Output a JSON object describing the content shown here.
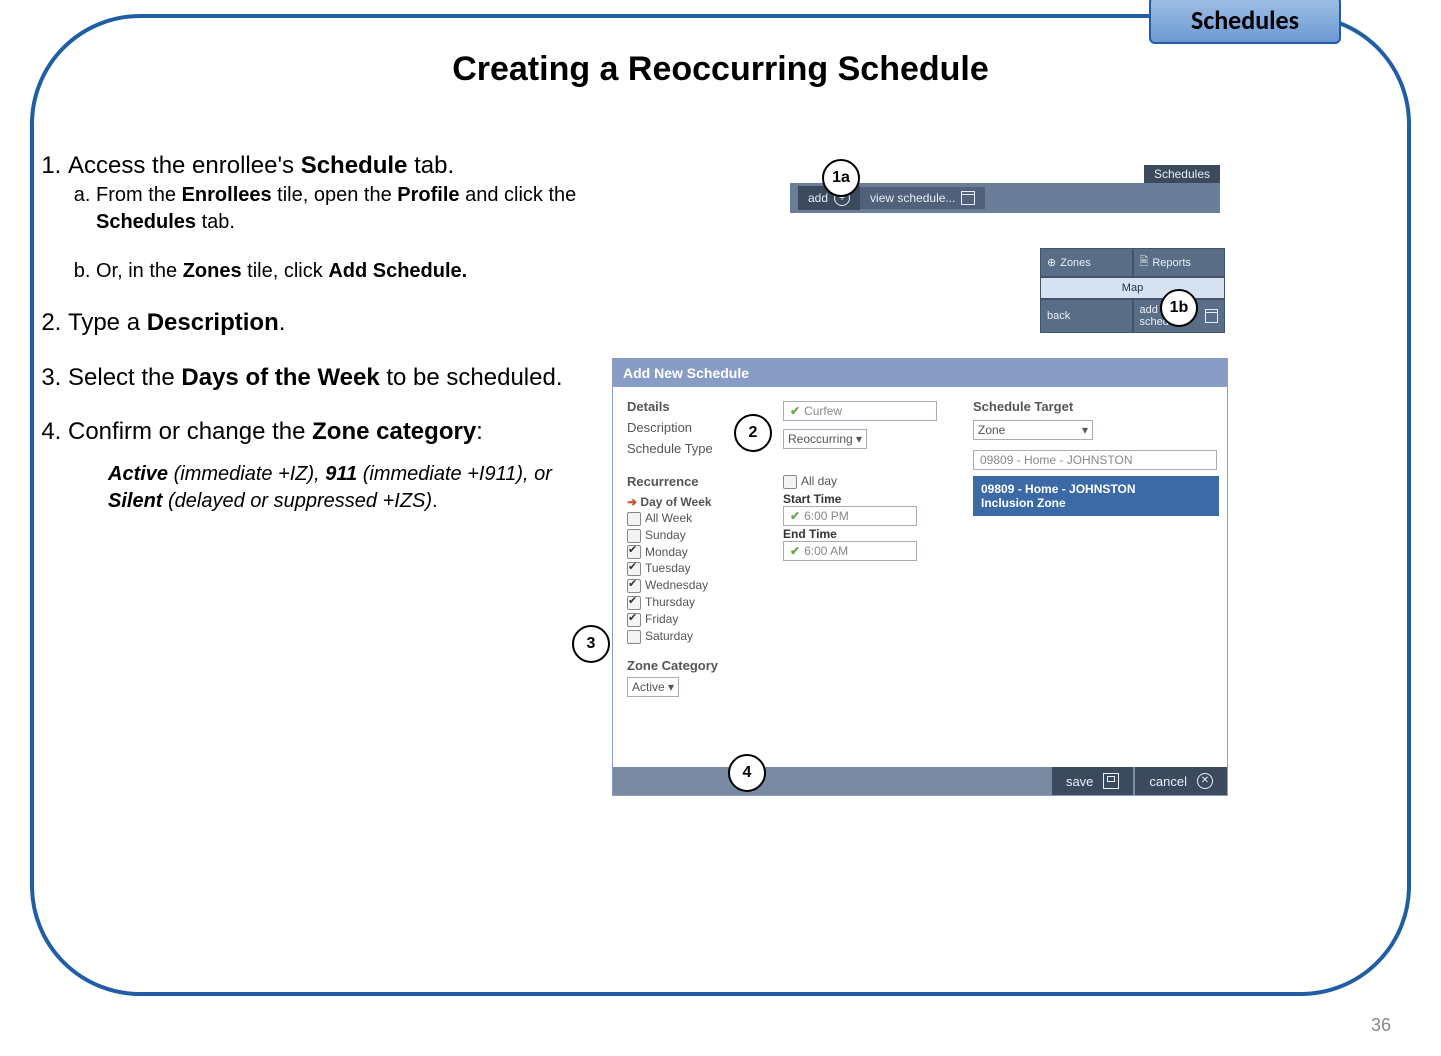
{
  "page": {
    "tab_label": "Schedules",
    "title": "Creating a Reoccurring Schedule",
    "page_number": "36"
  },
  "steps": {
    "s1": "Access the enrollee's ",
    "s1_bold": "Schedule",
    "s1_tail": " tab.",
    "s1a_pre": "From the ",
    "s1a_b1": "Enrollees",
    "s1a_mid": " tile, open the ",
    "s1a_b2": "Profile",
    "s1a_mid2": " and click the ",
    "s1a_b3": "Schedules",
    "s1a_tail": " tab.",
    "s1b_pre": "Or, in the ",
    "s1b_b1": "Zones",
    "s1b_mid": " tile, click ",
    "s1b_b2": "Add Schedule.",
    "s2_pre": "Type a ",
    "s2_b": "Description",
    "s2_tail": ".",
    "s3_pre": "Select the ",
    "s3_b": "Days of the Week",
    "s3_tail": " to be scheduled.",
    "s4_pre": "Confirm or change the ",
    "s4_b": "Zone category",
    "s4_tail": ":",
    "note_b1": "Active",
    "note_t1": " (immediate +IZ), ",
    "note_b2": "911",
    "note_t2": " (immediate +I911), or ",
    "note_b3": "Silent",
    "note_t3": " (delayed or suppressed +IZS)",
    "note_tail": "."
  },
  "shot1a": {
    "schedules": "Schedules",
    "add": "add",
    "view": "view schedule..."
  },
  "shot1b": {
    "zones": "Zones",
    "reports": "Reports",
    "map": "Map",
    "back": "back",
    "add_schedule": "add schedule"
  },
  "panel": {
    "header": "Add New Schedule",
    "details": "Details",
    "description_lbl": "Description",
    "description_val": "Curfew",
    "schedule_type_lbl": "Schedule Type",
    "schedule_type_val": "Reoccurring",
    "recurrence": "Recurrence",
    "day_of_week": "Day of Week",
    "all_week": "All Week",
    "days": {
      "sun": "Sunday",
      "mon": "Monday",
      "tue": "Tuesday",
      "wed": "Wednesday",
      "thu": "Thursday",
      "fri": "Friday",
      "sat": "Saturday"
    },
    "all_day": "All day",
    "start_time_lbl": "Start Time",
    "start_time_val": "6:00 PM",
    "end_time_lbl": "End Time",
    "end_time_val": "6:00 AM",
    "zone_category_lbl": "Zone Category",
    "zone_category_val": "Active",
    "schedule_target": "Schedule Target",
    "target_sel": "Zone",
    "target_val": "09809 - Home - JOHNSTON",
    "target_highlight_l1": "09809 - Home - JOHNSTON",
    "target_highlight_l2": "Inclusion Zone",
    "save": "save",
    "cancel": "cancel"
  },
  "callouts": {
    "c1a": "1a",
    "c1b": "1b",
    "c2": "2",
    "c3": "3",
    "c4": "4"
  }
}
